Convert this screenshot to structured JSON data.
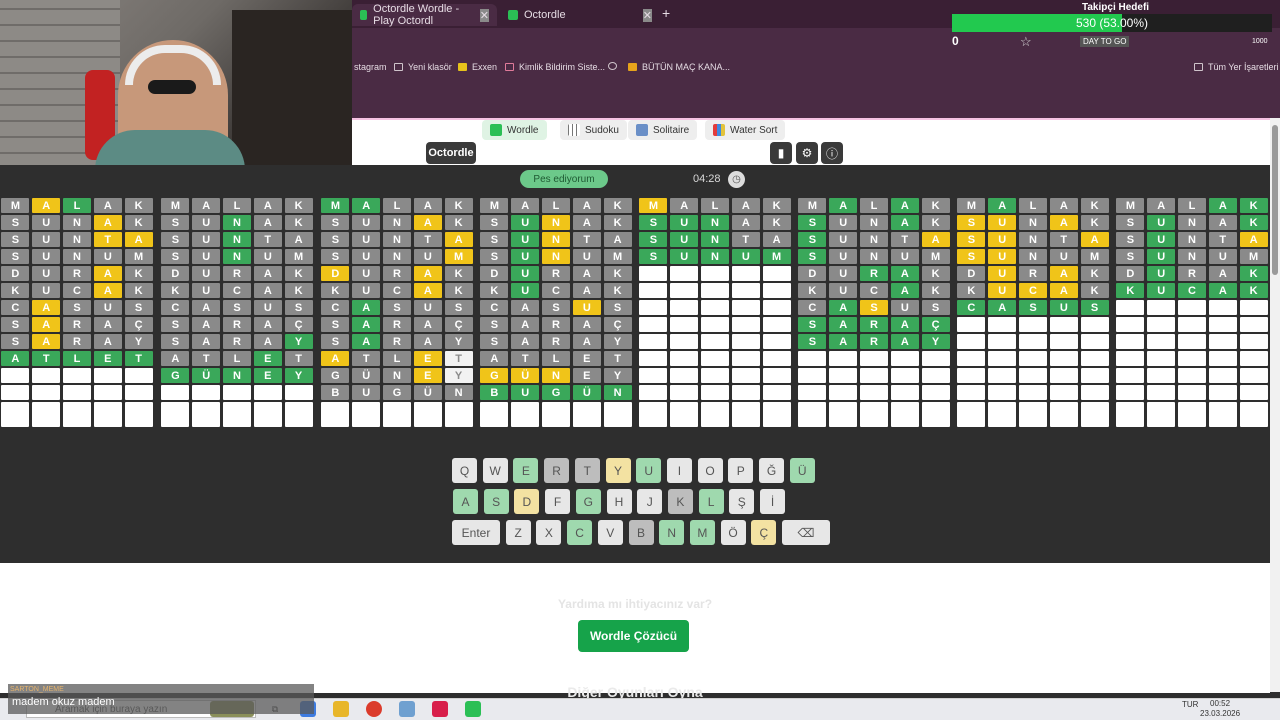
{
  "browser": {
    "tabs": [
      {
        "label": "Octordle Wordle - Play Octordl"
      },
      {
        "label": "Octordle"
      }
    ],
    "bookmarks": [
      "stagram",
      "Yeni klasör",
      "Exxen",
      "Kimlik Bildirim Siste...",
      "BÜTÜN MAÇ KANA...",
      "Tüm Yer İşaretleri"
    ],
    "toolbar_text": "DAY TO GO",
    "toolbar_count": "1000"
  },
  "overlay": {
    "title": "Takipçi Hedefi",
    "progress_text": "530 (53.00%)",
    "progress_fraction": 0.53,
    "count": "0"
  },
  "site": {
    "game_tabs": [
      "Wordle",
      "Sudoku",
      "Solitaire",
      "Water Sort"
    ],
    "brand": "Octordle",
    "give_up": "Pes ediyorum",
    "timer": "04:28"
  },
  "boards": [
    {
      "rows": [
        [
          "xM",
          "yA",
          "gL",
          "xA",
          "xK"
        ],
        [
          "xS",
          "xU",
          "xN",
          "yA",
          "xK"
        ],
        [
          "xS",
          "xU",
          "xN",
          "yT",
          "yA"
        ],
        [
          "xS",
          "xU",
          "xN",
          "xU",
          "xM"
        ],
        [
          "xD",
          "xU",
          "xR",
          "yA",
          "xK"
        ],
        [
          "xK",
          "xU",
          "xC",
          "yA",
          "xK"
        ],
        [
          "xC",
          "yA",
          "xS",
          "xU",
          "xS"
        ],
        [
          "xS",
          "yA",
          "xR",
          "xA",
          "xÇ"
        ],
        [
          "xS",
          "yA",
          "xR",
          "xA",
          "xY"
        ],
        [
          "gA",
          "gT",
          "gL",
          "gE",
          "gT"
        ],
        [
          "e",
          "e",
          "e",
          "e",
          "e"
        ],
        [
          "e",
          "e",
          "e",
          "e",
          "e"
        ],
        [
          "e",
          "e",
          "e",
          "e",
          "e"
        ]
      ]
    },
    {
      "rows": [
        [
          "xM",
          "xA",
          "xL",
          "xA",
          "xK"
        ],
        [
          "xS",
          "xU",
          "gN",
          "xA",
          "xK"
        ],
        [
          "xS",
          "xU",
          "gN",
          "xT",
          "xA"
        ],
        [
          "xS",
          "xU",
          "gN",
          "xU",
          "xM"
        ],
        [
          "xD",
          "xU",
          "xR",
          "xA",
          "xK"
        ],
        [
          "xK",
          "xU",
          "xC",
          "xA",
          "xK"
        ],
        [
          "xC",
          "xA",
          "xS",
          "xU",
          "xS"
        ],
        [
          "xS",
          "xA",
          "xR",
          "xA",
          "xÇ"
        ],
        [
          "xS",
          "xA",
          "xR",
          "xA",
          "gY"
        ],
        [
          "xA",
          "xT",
          "xL",
          "gE",
          "xT"
        ],
        [
          "gG",
          "gÜ",
          "gN",
          "gE",
          "gY"
        ],
        [
          "e",
          "e",
          "e",
          "e",
          "e"
        ],
        [
          "e",
          "e",
          "e",
          "e",
          "e"
        ]
      ]
    },
    {
      "rows": [
        [
          "gM",
          "gA",
          "xL",
          "xA",
          "xK"
        ],
        [
          "xS",
          "xU",
          "xN",
          "yA",
          "xK"
        ],
        [
          "xS",
          "xU",
          "xN",
          "xT",
          "yA"
        ],
        [
          "xS",
          "xU",
          "xN",
          "xU",
          "yM"
        ],
        [
          "yD",
          "xU",
          "xR",
          "yA",
          "xK"
        ],
        [
          "xK",
          "xU",
          "xC",
          "yA",
          "xK"
        ],
        [
          "xC",
          "gA",
          "xS",
          "xU",
          "xS"
        ],
        [
          "xS",
          "gA",
          "xR",
          "xA",
          "xÇ"
        ],
        [
          "xS",
          "gA",
          "xR",
          "xA",
          "xY"
        ],
        [
          "yA",
          "xT",
          "xL",
          "yE",
          "tT"
        ],
        [
          "xG",
          "xÜ",
          "xN",
          "yE",
          "tY"
        ],
        [
          "xB",
          "xU",
          "xG",
          "xÜ",
          "xN"
        ],
        [
          "e",
          "e",
          "e",
          "e",
          "e"
        ]
      ]
    },
    {
      "rows": [
        [
          "xM",
          "xA",
          "xL",
          "xA",
          "xK"
        ],
        [
          "xS",
          "gU",
          "yN",
          "xA",
          "xK"
        ],
        [
          "xS",
          "gU",
          "yN",
          "xT",
          "xA"
        ],
        [
          "xS",
          "gU",
          "yN",
          "xU",
          "xM"
        ],
        [
          "xD",
          "gU",
          "xR",
          "xA",
          "xK"
        ],
        [
          "xK",
          "gU",
          "xC",
          "xA",
          "xK"
        ],
        [
          "xC",
          "xA",
          "xS",
          "yU",
          "xS"
        ],
        [
          "xS",
          "xA",
          "xR",
          "xA",
          "xÇ"
        ],
        [
          "xS",
          "xA",
          "xR",
          "xA",
          "xY"
        ],
        [
          "xA",
          "xT",
          "xL",
          "xE",
          "xT"
        ],
        [
          "yG",
          "yÜ",
          "yN",
          "xE",
          "xY"
        ],
        [
          "gB",
          "gU",
          "gG",
          "gÜ",
          "gN"
        ],
        [
          "e",
          "e",
          "e",
          "e",
          "e"
        ]
      ]
    },
    {
      "rows": [
        [
          "yM",
          "xA",
          "xL",
          "xA",
          "xK"
        ],
        [
          "gS",
          "gU",
          "gN",
          "xA",
          "xK"
        ],
        [
          "gS",
          "gU",
          "gN",
          "xT",
          "xA"
        ],
        [
          "gS",
          "gU",
          "gN",
          "gU",
          "gM"
        ],
        [
          "e",
          "e",
          "e",
          "e",
          "e"
        ],
        [
          "e",
          "e",
          "e",
          "e",
          "e"
        ],
        [
          "e",
          "e",
          "e",
          "e",
          "e"
        ],
        [
          "e",
          "e",
          "e",
          "e",
          "e"
        ],
        [
          "e",
          "e",
          "e",
          "e",
          "e"
        ],
        [
          "e",
          "e",
          "e",
          "e",
          "e"
        ],
        [
          "e",
          "e",
          "e",
          "e",
          "e"
        ],
        [
          "e",
          "e",
          "e",
          "e",
          "e"
        ],
        [
          "e",
          "e",
          "e",
          "e",
          "e"
        ]
      ]
    },
    {
      "rows": [
        [
          "xM",
          "gA",
          "xL",
          "gA",
          "xK"
        ],
        [
          "gS",
          "xU",
          "xN",
          "gA",
          "xK"
        ],
        [
          "gS",
          "xU",
          "xN",
          "xT",
          "yA"
        ],
        [
          "gS",
          "xU",
          "xN",
          "xU",
          "xM"
        ],
        [
          "xD",
          "xU",
          "gR",
          "gA",
          "xK"
        ],
        [
          "xK",
          "xU",
          "xC",
          "gA",
          "xK"
        ],
        [
          "xC",
          "gA",
          "yS",
          "xU",
          "xS"
        ],
        [
          "gS",
          "gA",
          "gR",
          "gA",
          "gÇ"
        ],
        [
          "gS",
          "gA",
          "gR",
          "gA",
          "gY"
        ],
        [
          "e",
          "e",
          "e",
          "e",
          "e"
        ],
        [
          "e",
          "e",
          "e",
          "e",
          "e"
        ],
        [
          "e",
          "e",
          "e",
          "e",
          "e"
        ],
        [
          "e",
          "e",
          "e",
          "e",
          "e"
        ]
      ]
    },
    {
      "rows": [
        [
          "xM",
          "gA",
          "xL",
          "xA",
          "xK"
        ],
        [
          "yS",
          "yU",
          "xN",
          "yA",
          "xK"
        ],
        [
          "yS",
          "yU",
          "xN",
          "xT",
          "yA"
        ],
        [
          "yS",
          "yU",
          "xN",
          "xU",
          "xM"
        ],
        [
          "xD",
          "yU",
          "xR",
          "yA",
          "xK"
        ],
        [
          "xK",
          "yU",
          "yC",
          "yA",
          "xK"
        ],
        [
          "gC",
          "gA",
          "gS",
          "gU",
          "gS"
        ],
        [
          "e",
          "e",
          "e",
          "e",
          "e"
        ],
        [
          "e",
          "e",
          "e",
          "e",
          "e"
        ],
        [
          "e",
          "e",
          "e",
          "e",
          "e"
        ],
        [
          "e",
          "e",
          "e",
          "e",
          "e"
        ],
        [
          "e",
          "e",
          "e",
          "e",
          "e"
        ],
        [
          "e",
          "e",
          "e",
          "e",
          "e"
        ]
      ]
    },
    {
      "rows": [
        [
          "xM",
          "xA",
          "xL",
          "gA",
          "gK"
        ],
        [
          "xS",
          "gU",
          "xN",
          "xA",
          "gK"
        ],
        [
          "xS",
          "gU",
          "xN",
          "xT",
          "yA"
        ],
        [
          "xS",
          "gU",
          "xN",
          "xU",
          "xM"
        ],
        [
          "xD",
          "gU",
          "xR",
          "xA",
          "gK"
        ],
        [
          "gK",
          "gU",
          "gC",
          "gA",
          "gK"
        ],
        [
          "e",
          "e",
          "e",
          "e",
          "e"
        ],
        [
          "e",
          "e",
          "e",
          "e",
          "e"
        ],
        [
          "e",
          "e",
          "e",
          "e",
          "e"
        ],
        [
          "e",
          "e",
          "e",
          "e",
          "e"
        ],
        [
          "e",
          "e",
          "e",
          "e",
          "e"
        ],
        [
          "e",
          "e",
          "e",
          "e",
          "e"
        ],
        [
          "e",
          "e",
          "e",
          "e",
          "e"
        ]
      ]
    }
  ],
  "keyboard": {
    "row1": [
      [
        "Q",
        ""
      ],
      [
        "W",
        ""
      ],
      [
        "E",
        "kg"
      ],
      [
        "R",
        "kx"
      ],
      [
        "T",
        "kx"
      ],
      [
        "Y",
        "ky"
      ],
      [
        "U",
        "kg"
      ],
      [
        "I",
        ""
      ],
      [
        "O",
        ""
      ],
      [
        "P",
        ""
      ],
      [
        "Ğ",
        ""
      ],
      [
        "Ü",
        "kg"
      ]
    ],
    "row2": [
      [
        "A",
        "kg"
      ],
      [
        "S",
        "kg"
      ],
      [
        "D",
        "ky"
      ],
      [
        "F",
        ""
      ],
      [
        "G",
        "kg"
      ],
      [
        "H",
        ""
      ],
      [
        "J",
        ""
      ],
      [
        "K",
        "kx"
      ],
      [
        "L",
        "kg"
      ],
      [
        "Ş",
        ""
      ],
      [
        "İ",
        ""
      ]
    ],
    "row3": [
      [
        "Enter",
        ""
      ],
      [
        "Z",
        ""
      ],
      [
        "X",
        ""
      ],
      [
        "C",
        "kg"
      ],
      [
        "V",
        ""
      ],
      [
        "B",
        "kx"
      ],
      [
        "N",
        "kg"
      ],
      [
        "M",
        "kg"
      ],
      [
        "Ö",
        ""
      ],
      [
        "Ç",
        "ky"
      ],
      [
        "⌫",
        ""
      ]
    ]
  },
  "lower": {
    "help": "Yardıma mı ihtiyacınız var?",
    "solver_button": "Wordle Çözücü",
    "other_games": "Diğer Oyunları Oyna"
  },
  "taskbar": {
    "search_placeholder": "Aramak için buraya yazın",
    "lang": "TUR",
    "time": "00:52",
    "date": "23.03.2026"
  },
  "stream": {
    "label": "SARTON_MEME",
    "message": "madem okuz madem"
  }
}
